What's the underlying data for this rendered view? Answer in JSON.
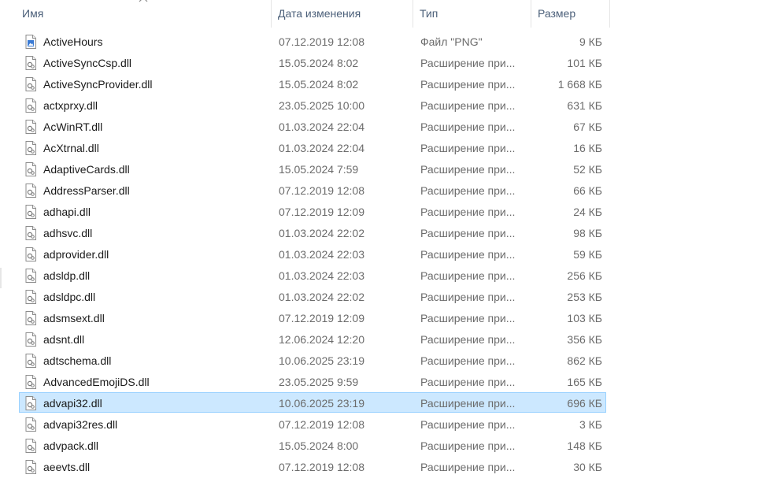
{
  "columns": {
    "name": "Имя",
    "date": "Дата изменения",
    "type": "Тип",
    "size": "Размер"
  },
  "files": [
    {
      "name": "ActiveHours",
      "date": "07.12.2019 12:08",
      "type": "Файл \"PNG\"",
      "size": "9 КБ",
      "icon": "png-file-icon",
      "selected": false
    },
    {
      "name": "ActiveSyncCsp.dll",
      "date": "15.05.2024 8:02",
      "type": "Расширение при...",
      "size": "101 КБ",
      "icon": "dll-file-icon",
      "selected": false
    },
    {
      "name": "ActiveSyncProvider.dll",
      "date": "15.05.2024 8:02",
      "type": "Расширение при...",
      "size": "1 668 КБ",
      "icon": "dll-file-icon",
      "selected": false
    },
    {
      "name": "actxprxy.dll",
      "date": "23.05.2025 10:00",
      "type": "Расширение при...",
      "size": "631 КБ",
      "icon": "dll-file-icon",
      "selected": false
    },
    {
      "name": "AcWinRT.dll",
      "date": "01.03.2024 22:04",
      "type": "Расширение при...",
      "size": "67 КБ",
      "icon": "dll-file-icon",
      "selected": false
    },
    {
      "name": "AcXtrnal.dll",
      "date": "01.03.2024 22:04",
      "type": "Расширение при...",
      "size": "16 КБ",
      "icon": "dll-file-icon",
      "selected": false
    },
    {
      "name": "AdaptiveCards.dll",
      "date": "15.05.2024 7:59",
      "type": "Расширение при...",
      "size": "52 КБ",
      "icon": "dll-file-icon",
      "selected": false
    },
    {
      "name": "AddressParser.dll",
      "date": "07.12.2019 12:08",
      "type": "Расширение при...",
      "size": "66 КБ",
      "icon": "dll-file-icon",
      "selected": false
    },
    {
      "name": "adhapi.dll",
      "date": "07.12.2019 12:09",
      "type": "Расширение при...",
      "size": "24 КБ",
      "icon": "dll-file-icon",
      "selected": false
    },
    {
      "name": "adhsvc.dll",
      "date": "01.03.2024 22:02",
      "type": "Расширение при...",
      "size": "98 КБ",
      "icon": "dll-file-icon",
      "selected": false
    },
    {
      "name": "adprovider.dll",
      "date": "01.03.2024 22:03",
      "type": "Расширение при...",
      "size": "59 КБ",
      "icon": "dll-file-icon",
      "selected": false
    },
    {
      "name": "adsldp.dll",
      "date": "01.03.2024 22:03",
      "type": "Расширение при...",
      "size": "256 КБ",
      "icon": "dll-file-icon",
      "selected": false
    },
    {
      "name": "adsldpc.dll",
      "date": "01.03.2024 22:02",
      "type": "Расширение при...",
      "size": "253 КБ",
      "icon": "dll-file-icon",
      "selected": false
    },
    {
      "name": "adsmsext.dll",
      "date": "07.12.2019 12:09",
      "type": "Расширение при...",
      "size": "103 КБ",
      "icon": "dll-file-icon",
      "selected": false
    },
    {
      "name": "adsnt.dll",
      "date": "12.06.2024 12:20",
      "type": "Расширение при...",
      "size": "356 КБ",
      "icon": "dll-file-icon",
      "selected": false
    },
    {
      "name": "adtschema.dll",
      "date": "10.06.2025 23:19",
      "type": "Расширение при...",
      "size": "862 КБ",
      "icon": "dll-file-icon",
      "selected": false
    },
    {
      "name": "AdvancedEmojiDS.dll",
      "date": "23.05.2025 9:59",
      "type": "Расширение при...",
      "size": "165 КБ",
      "icon": "dll-file-icon",
      "selected": false
    },
    {
      "name": "advapi32.dll",
      "date": "10.06.2025 23:19",
      "type": "Расширение при...",
      "size": "696 КБ",
      "icon": "dll-file-icon",
      "selected": true
    },
    {
      "name": "advapi32res.dll",
      "date": "07.12.2019 12:08",
      "type": "Расширение при...",
      "size": "3 КБ",
      "icon": "dll-file-icon",
      "selected": false
    },
    {
      "name": "advpack.dll",
      "date": "15.05.2024 8:00",
      "type": "Расширение при...",
      "size": "148 КБ",
      "icon": "dll-file-icon",
      "selected": false
    },
    {
      "name": "aeevts.dll",
      "date": "07.12.2019 12:08",
      "type": "Расширение при...",
      "size": "30 КБ",
      "icon": "dll-file-icon",
      "selected": false
    }
  ],
  "colors": {
    "header_text": "#4c607a",
    "selection_bg": "#cce8ff",
    "selection_border": "#99d1ff",
    "secondary_text": "#6b6b6b"
  }
}
